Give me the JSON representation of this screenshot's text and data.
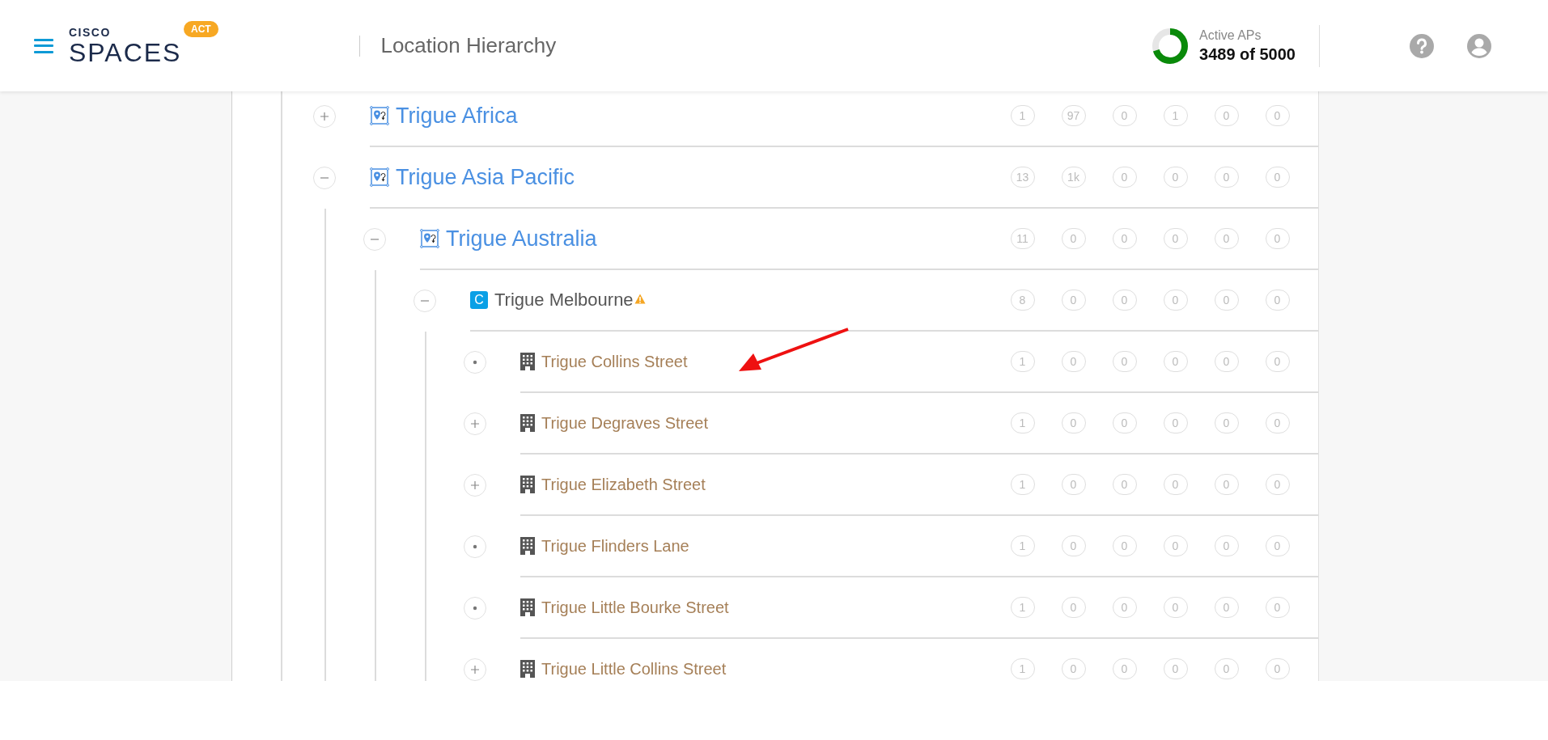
{
  "header": {
    "logo": {
      "top": "CISCO",
      "bottom": "SPACES"
    },
    "badge": "ACT",
    "title": "Location Hierarchy",
    "active_aps": {
      "label": "Active APs",
      "value": "3489 of 5000",
      "level": 0.698
    }
  },
  "tree": [
    {
      "name": "Trigue Africa",
      "kind": "region",
      "leaf": false,
      "expanded": false,
      "counts": [
        "1",
        "97",
        "0",
        "1",
        "0",
        "0"
      ]
    },
    {
      "name": "Trigue Asia Pacific",
      "kind": "region",
      "leaf": false,
      "expanded": true,
      "counts": [
        "13",
        "1k",
        "0",
        "0",
        "0",
        "0"
      ],
      "children": [
        {
          "name": "Trigue Australia",
          "kind": "region",
          "leaf": false,
          "expanded": true,
          "counts": [
            "11",
            "0",
            "0",
            "0",
            "0",
            "0"
          ],
          "children": [
            {
              "name": "Trigue Melbourne",
              "kind": "campus",
              "badge": "C",
              "warning": true,
              "leaf": false,
              "expanded": true,
              "counts": [
                "8",
                "0",
                "0",
                "0",
                "0",
                "0"
              ],
              "children": [
                {
                  "name": "Trigue Collins Street",
                  "kind": "building",
                  "leaf": true,
                  "expanded": false,
                  "counts": [
                    "1",
                    "0",
                    "0",
                    "0",
                    "0",
                    "0"
                  ]
                },
                {
                  "name": "Trigue Degraves Street",
                  "kind": "building",
                  "leaf": false,
                  "expanded": false,
                  "counts": [
                    "1",
                    "0",
                    "0",
                    "0",
                    "0",
                    "0"
                  ]
                },
                {
                  "name": "Trigue Elizabeth Street",
                  "kind": "building",
                  "leaf": false,
                  "expanded": false,
                  "counts": [
                    "1",
                    "0",
                    "0",
                    "0",
                    "0",
                    "0"
                  ]
                },
                {
                  "name": "Trigue Flinders Lane",
                  "kind": "building",
                  "leaf": true,
                  "expanded": false,
                  "counts": [
                    "1",
                    "0",
                    "0",
                    "0",
                    "0",
                    "0"
                  ]
                },
                {
                  "name": "Trigue Little Bourke Street",
                  "kind": "building",
                  "leaf": true,
                  "expanded": false,
                  "counts": [
                    "1",
                    "0",
                    "0",
                    "0",
                    "0",
                    "0"
                  ]
                },
                {
                  "name": "Trigue Little Collins Street",
                  "kind": "building",
                  "leaf": false,
                  "expanded": false,
                  "counts": [
                    "1",
                    "0",
                    "0",
                    "0",
                    "0",
                    "0"
                  ]
                }
              ]
            }
          ]
        }
      ]
    }
  ]
}
